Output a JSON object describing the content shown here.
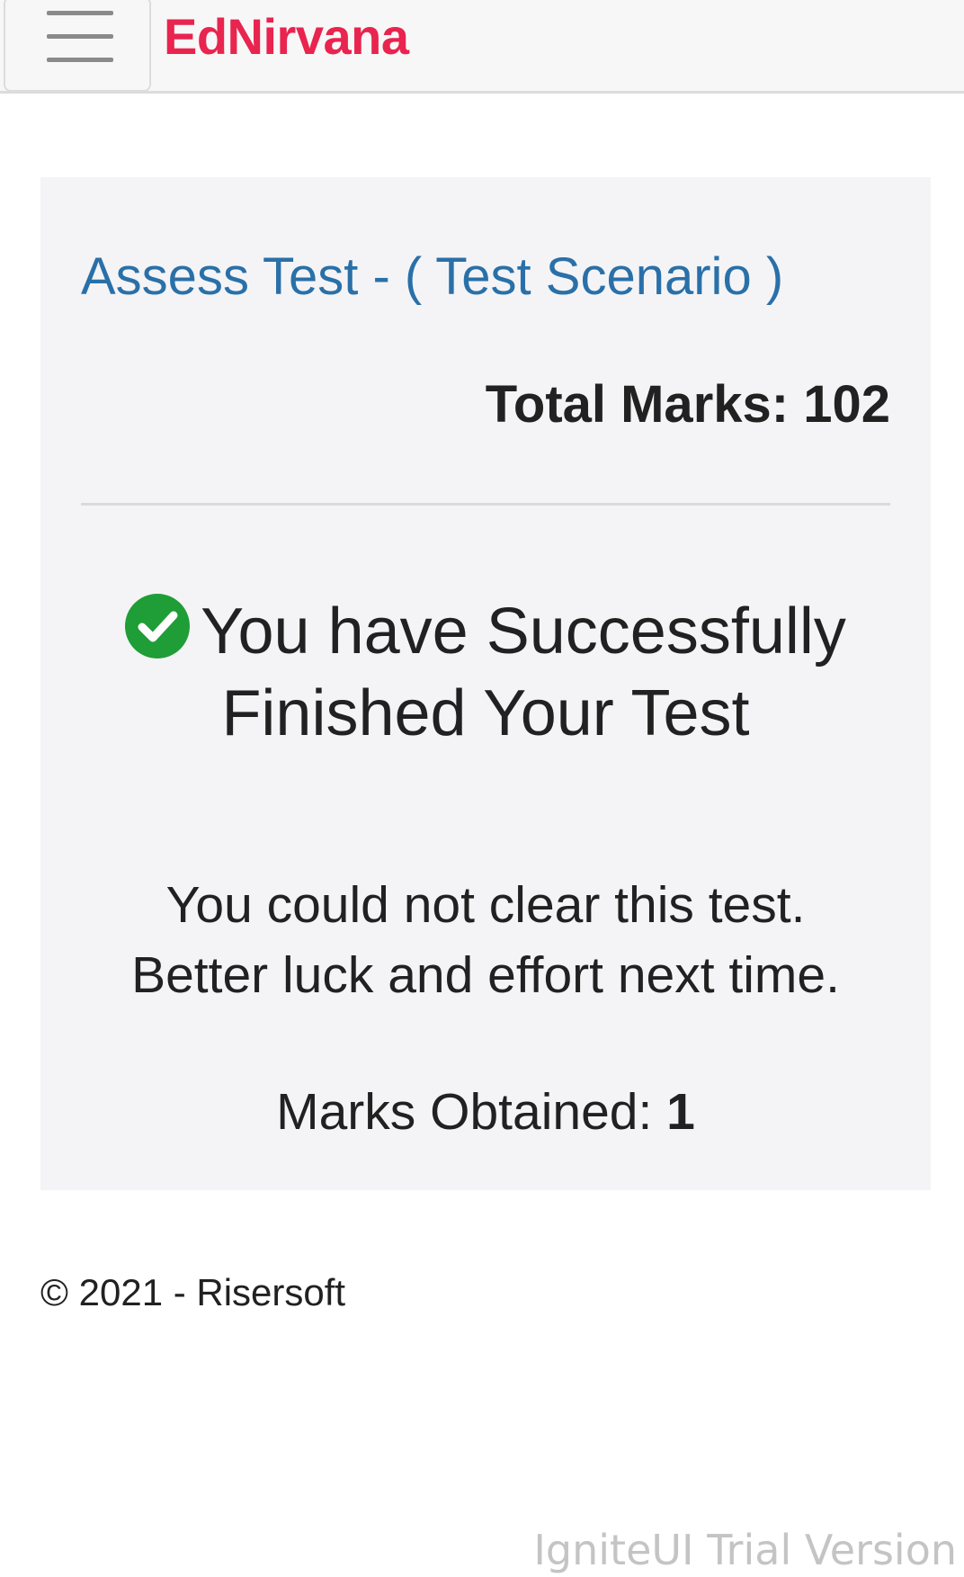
{
  "header": {
    "brand": "EdNirvana",
    "menu_icon": "hamburger-menu-icon"
  },
  "test": {
    "title": "Assess Test - ( Test Scenario )",
    "total_marks_label": "Total Marks:",
    "total_marks_value": "102"
  },
  "result": {
    "status_icon": "check-circle-icon",
    "status_color": "#1f9d37",
    "success_line1": "You have Successfully",
    "success_line2": "Finished Your Test",
    "fail_line1": "You could not clear this test.",
    "fail_line2": "Better luck and effort next time.",
    "marks_obtained_label": "Marks Obtained:",
    "marks_obtained_value": "1"
  },
  "footer": {
    "copyright": "© 2021 - Risersoft"
  },
  "watermark": "IgniteUI Trial Version",
  "colors": {
    "brand": "#e8244f",
    "title": "#2a70a8",
    "panel_bg": "#f4f4f6"
  }
}
